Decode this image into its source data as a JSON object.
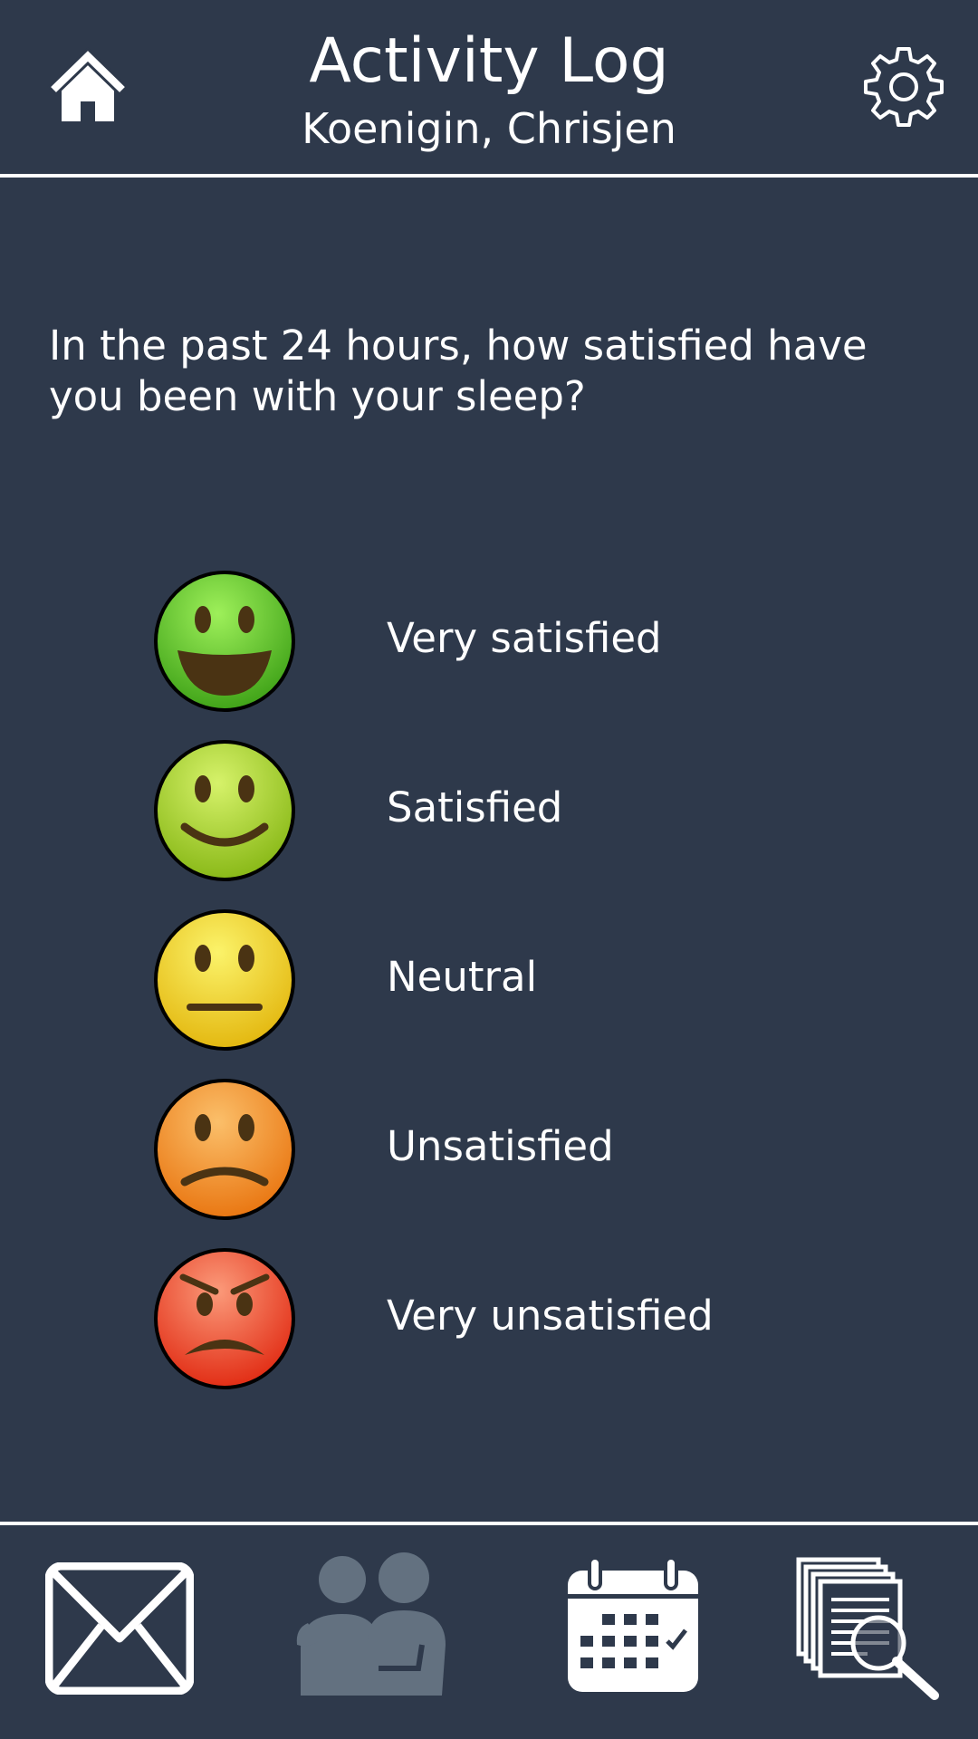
{
  "header": {
    "title": "Activity Log",
    "subtitle": "Koenigin, Chrisjen",
    "left_icon": "home-icon",
    "right_icon": "gear-icon"
  },
  "question": "In the past 24 hours, how satisfied have you been with your sleep?",
  "options": [
    {
      "label": "Very satisfied",
      "icon": "very-happy-face-icon",
      "color": "#5cbf2a"
    },
    {
      "label": "Satisfied",
      "icon": "happy-face-icon",
      "color": "#9ccb1e"
    },
    {
      "label": "Neutral",
      "icon": "neutral-face-icon",
      "color": "#f2d81a"
    },
    {
      "label": "Unsatisfied",
      "icon": "sad-face-icon",
      "color": "#f28c1c"
    },
    {
      "label": "Very unsatisfied",
      "icon": "angry-face-icon",
      "color": "#ee3d1f"
    }
  ],
  "bottom_nav": [
    {
      "icon": "mail-icon",
      "active": true
    },
    {
      "icon": "care-team-icon",
      "active": false
    },
    {
      "icon": "calendar-icon",
      "active": true
    },
    {
      "icon": "documents-search-icon",
      "active": true
    }
  ],
  "colors": {
    "background": "#2e394b",
    "foreground": "#ffffff",
    "inactive": "#637180"
  }
}
